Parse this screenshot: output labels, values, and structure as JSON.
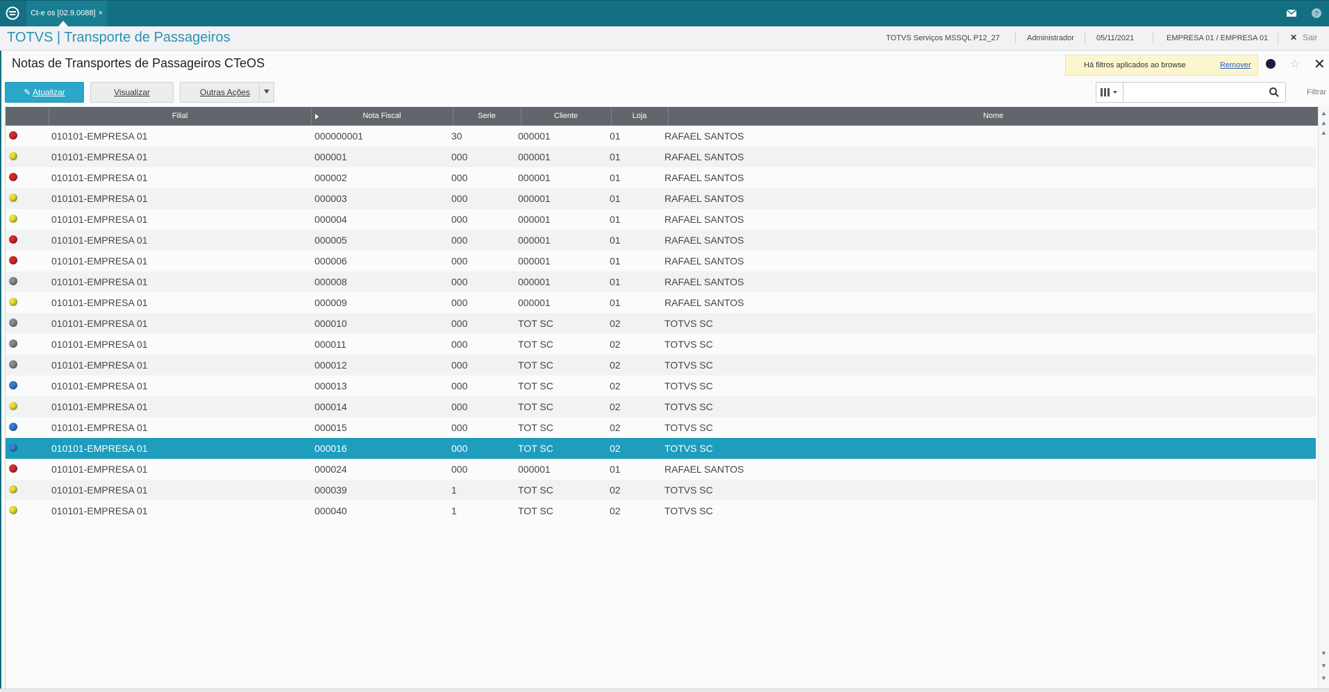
{
  "window": {
    "tab_label": "Ct-e os [02.9.0088]",
    "tab_close": "×"
  },
  "header": {
    "title": "TOTVS | Transporte de Passageiros",
    "server": "TOTVS Serviços MSSQL P12_27",
    "user": "Administrador",
    "date": "05/11/2021",
    "company": "EMPRESA 01 / EMPRESA 01",
    "exit_label": "Sair"
  },
  "page": {
    "title": "Notas de Transportes de Passageiros CTeOS",
    "filter_notice": "Há filtros aplicados ao browse",
    "remove_label": "Remover"
  },
  "toolbar": {
    "atualizar_label": "Atualizar",
    "visualizar_label": "Visualizar",
    "outras_label": "Outras Ações",
    "search_placeholder": "",
    "filtrar_label": "Filtrar"
  },
  "colors": {
    "red": "#d92a2a",
    "yellow": "#e8e13a",
    "gray": "#8a8d90",
    "blue": "#3a7fd0",
    "accent": "#1e9dbd",
    "topbar": "#136f82"
  },
  "table": {
    "columns": [
      "",
      "Filial",
      "Nota Fiscal",
      "Serie",
      "Cliente",
      "Loja",
      "Nome"
    ],
    "selected_index": 15,
    "rows": [
      {
        "status": "red",
        "filial": "010101-EMPRESA 01",
        "nota": "000000001",
        "serie": "30",
        "cliente": "000001",
        "loja": "01",
        "nome": "RAFAEL SANTOS"
      },
      {
        "status": "yellow",
        "filial": "010101-EMPRESA 01",
        "nota": "000001",
        "serie": "000",
        "cliente": "000001",
        "loja": "01",
        "nome": "RAFAEL SANTOS"
      },
      {
        "status": "red",
        "filial": "010101-EMPRESA 01",
        "nota": "000002",
        "serie": "000",
        "cliente": "000001",
        "loja": "01",
        "nome": "RAFAEL SANTOS"
      },
      {
        "status": "yellow",
        "filial": "010101-EMPRESA 01",
        "nota": "000003",
        "serie": "000",
        "cliente": "000001",
        "loja": "01",
        "nome": "RAFAEL SANTOS"
      },
      {
        "status": "yellow",
        "filial": "010101-EMPRESA 01",
        "nota": "000004",
        "serie": "000",
        "cliente": "000001",
        "loja": "01",
        "nome": "RAFAEL SANTOS"
      },
      {
        "status": "red",
        "filial": "010101-EMPRESA 01",
        "nota": "000005",
        "serie": "000",
        "cliente": "000001",
        "loja": "01",
        "nome": "RAFAEL SANTOS"
      },
      {
        "status": "red",
        "filial": "010101-EMPRESA 01",
        "nota": "000006",
        "serie": "000",
        "cliente": "000001",
        "loja": "01",
        "nome": "RAFAEL SANTOS"
      },
      {
        "status": "gray",
        "filial": "010101-EMPRESA 01",
        "nota": "000008",
        "serie": "000",
        "cliente": "000001",
        "loja": "01",
        "nome": "RAFAEL SANTOS"
      },
      {
        "status": "yellow",
        "filial": "010101-EMPRESA 01",
        "nota": "000009",
        "serie": "000",
        "cliente": "000001",
        "loja": "01",
        "nome": "RAFAEL SANTOS"
      },
      {
        "status": "gray",
        "filial": "010101-EMPRESA 01",
        "nota": "000010",
        "serie": "000",
        "cliente": "TOT SC",
        "loja": "02",
        "nome": "TOTVS SC"
      },
      {
        "status": "gray",
        "filial": "010101-EMPRESA 01",
        "nota": "000011",
        "serie": "000",
        "cliente": "TOT SC",
        "loja": "02",
        "nome": "TOTVS SC"
      },
      {
        "status": "gray",
        "filial": "010101-EMPRESA 01",
        "nota": "000012",
        "serie": "000",
        "cliente": "TOT SC",
        "loja": "02",
        "nome": "TOTVS SC"
      },
      {
        "status": "blue",
        "filial": "010101-EMPRESA 01",
        "nota": "000013",
        "serie": "000",
        "cliente": "TOT SC",
        "loja": "02",
        "nome": "TOTVS SC"
      },
      {
        "status": "yellow",
        "filial": "010101-EMPRESA 01",
        "nota": "000014",
        "serie": "000",
        "cliente": "TOT SC",
        "loja": "02",
        "nome": "TOTVS SC"
      },
      {
        "status": "blue",
        "filial": "010101-EMPRESA 01",
        "nota": "000015",
        "serie": "000",
        "cliente": "TOT SC",
        "loja": "02",
        "nome": "TOTVS SC"
      },
      {
        "status": "blue",
        "filial": "010101-EMPRESA 01",
        "nota": "000016",
        "serie": "000",
        "cliente": "TOT SC",
        "loja": "02",
        "nome": "TOTVS SC"
      },
      {
        "status": "red",
        "filial": "010101-EMPRESA 01",
        "nota": "000024",
        "serie": "000",
        "cliente": "000001",
        "loja": "01",
        "nome": "RAFAEL SANTOS"
      },
      {
        "status": "yellow",
        "filial": "010101-EMPRESA 01",
        "nota": "000039",
        "serie": "1",
        "cliente": "TOT SC",
        "loja": "02",
        "nome": "TOTVS SC"
      },
      {
        "status": "yellow",
        "filial": "010101-EMPRESA 01",
        "nota": "000040",
        "serie": "1",
        "cliente": "TOT SC",
        "loja": "02",
        "nome": "TOTVS SC"
      }
    ]
  }
}
